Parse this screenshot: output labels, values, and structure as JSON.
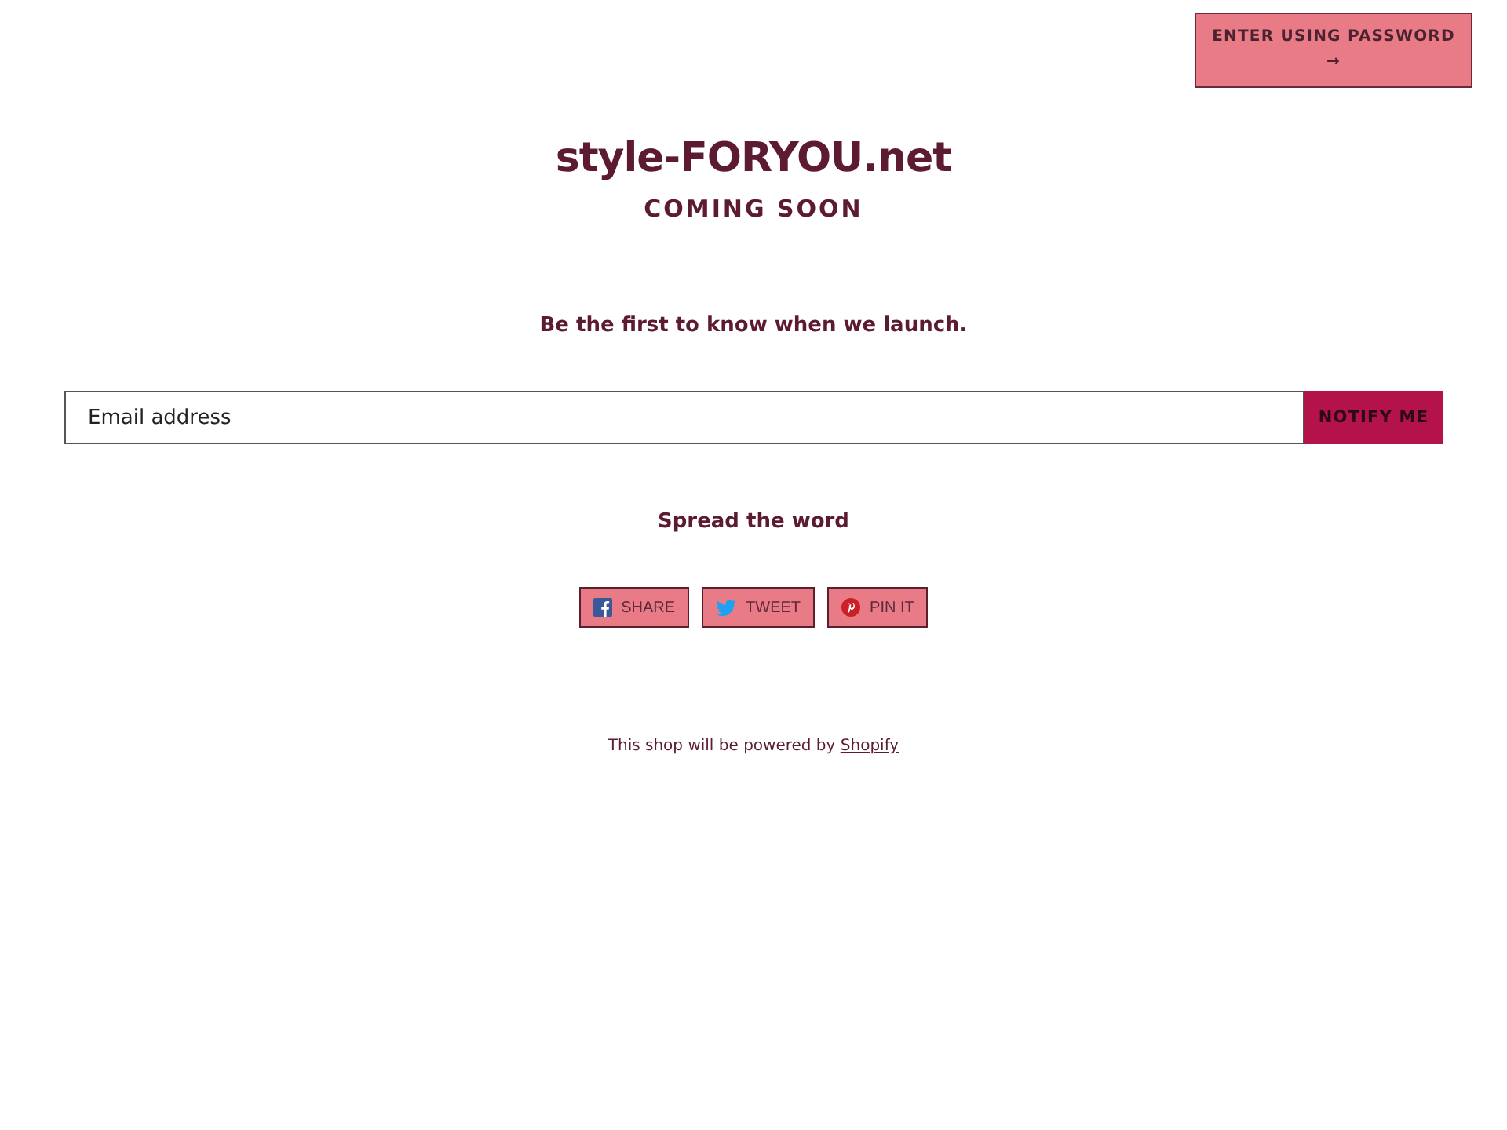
{
  "header_button": {
    "label": "ENTER USING PASSWORD",
    "arrow": "→"
  },
  "site_title": "style-FORYOU.net",
  "subtitle": "COMING SOON",
  "intro": "Be the first to know when we launch.",
  "signup": {
    "placeholder": "Email address",
    "button": "NOTIFY ME"
  },
  "share_heading": "Spread the word",
  "share_buttons": [
    {
      "kind": "facebook",
      "label": "SHARE"
    },
    {
      "kind": "twitter",
      "label": "TWEET"
    },
    {
      "kind": "pinterest",
      "label": "PIN IT"
    }
  ],
  "footer": {
    "text": "This shop will be powered by",
    "link": "Shopify"
  }
}
